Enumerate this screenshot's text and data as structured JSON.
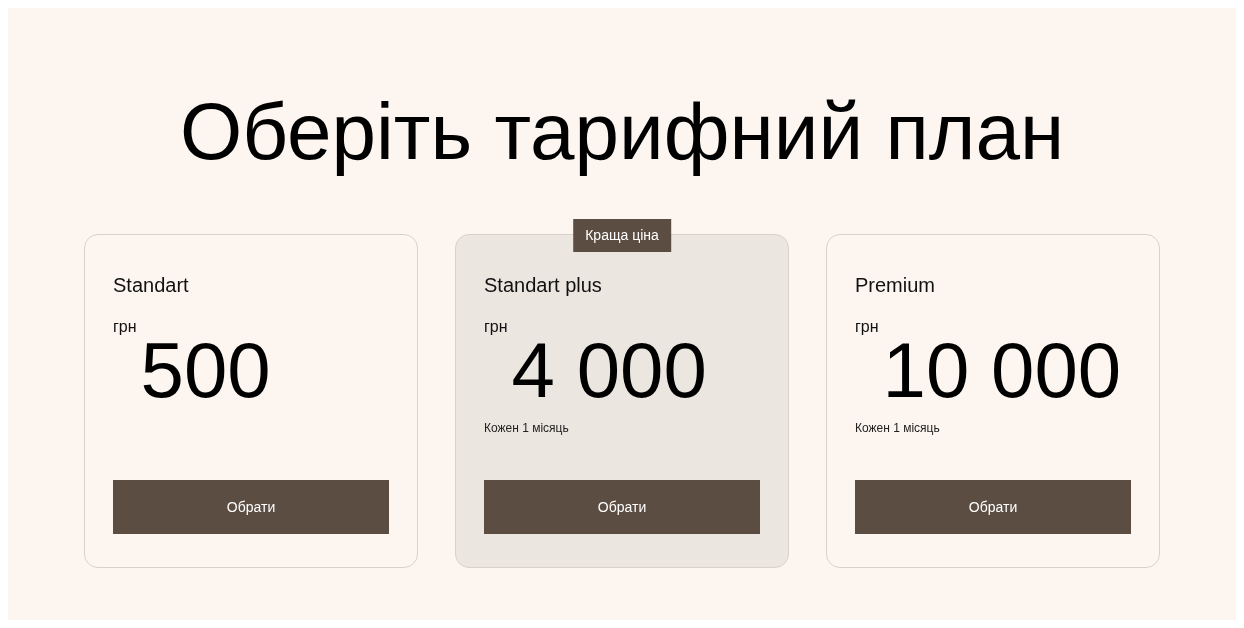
{
  "title": "Оберіть тарифний план",
  "plans": [
    {
      "name": "Standart",
      "currency": "грн",
      "price": "500",
      "featured": false,
      "button": "Обрати"
    },
    {
      "name": "Standart plus",
      "currency": "грн",
      "price": "4 000",
      "period": "Кожен 1 місяць",
      "featured": true,
      "badge": "Краща ціна",
      "button": "Обрати"
    },
    {
      "name": "Premium",
      "currency": "грн",
      "price": "10 000",
      "period": "Кожен 1 місяць",
      "featured": false,
      "button": "Обрати"
    }
  ]
}
